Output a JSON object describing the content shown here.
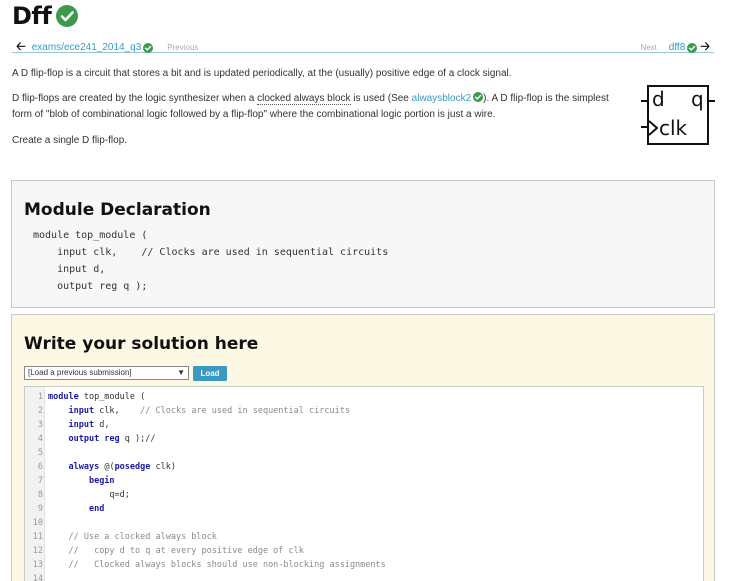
{
  "page": {
    "title": "Dff"
  },
  "nav": {
    "prev_link": "exams/ece241_2014_q3",
    "prev_label": "Previous",
    "next_label": "Next",
    "next_link": "dff8"
  },
  "description": {
    "p1": "A D flip-flop is a circuit that stores a bit and is updated periodically, at the (usually) positive edge of a clock signal.",
    "p2_a": "D flip-flops are created by the logic synthesizer when a ",
    "p2_term": "clocked always block",
    "p2_b": " is used (See ",
    "p2_link": "alwaysblock2",
    "p2_c": "). A D flip-flop is the simplest",
    "p2_d": "form of \"blob of combinational logic followed by a flip-flop\" where the combinational logic portion is just a wire.",
    "p3": "Create a single D flip-flop."
  },
  "diagram": {
    "d_label": "d",
    "q_label": "q",
    "clk_label": "clk"
  },
  "module_declaration": {
    "heading": "Module Declaration",
    "lines": [
      "module top_module (",
      "    input clk,    // Clocks are used in sequential circuits",
      "    input d,",
      "    output reg q );"
    ]
  },
  "solution": {
    "heading": "Write your solution here",
    "select_value": "[Load a previous submission]",
    "load_button": "Load",
    "line_numbers": [
      "1",
      "2",
      "3",
      "4",
      "5",
      "6",
      "7",
      "8",
      "9",
      "10",
      "11",
      "12",
      "13",
      "14"
    ],
    "code": {
      "l1_kw": "module",
      "l1_rest": " top_module (",
      "l2_kw": "input",
      "l2_rest": " clk,    ",
      "l2_cm": "// Clocks are used in sequential circuits",
      "l3_kw": "input",
      "l3_rest": " d,",
      "l4_kw": "output",
      "l4_kw2": " reg",
      "l4_rest": " q );//",
      "l6_kw": "always",
      "l6_a": " @(",
      "l6_kw2": "posedge",
      "l6_b": " clk)",
      "l7_kw": "begin",
      "l8_rest": "q=d;",
      "l9_kw": "end",
      "l11_cm": "// Use a clocked always block",
      "l12_cm": "//   copy d to q at every positive edge of clk",
      "l13_cm": "//   Clocked always blocks should use non-blocking assignments"
    }
  },
  "colors": {
    "link": "#3a9ac4",
    "check": "#3c9a4a",
    "solution_bg": "#fcf8e3",
    "module_bg": "#f7f7f7",
    "keyword": "#1a1aa6"
  },
  "icons": {
    "solved": "check-circle-icon",
    "back": "arrow-left-icon",
    "forward": "arrow-right-icon"
  }
}
